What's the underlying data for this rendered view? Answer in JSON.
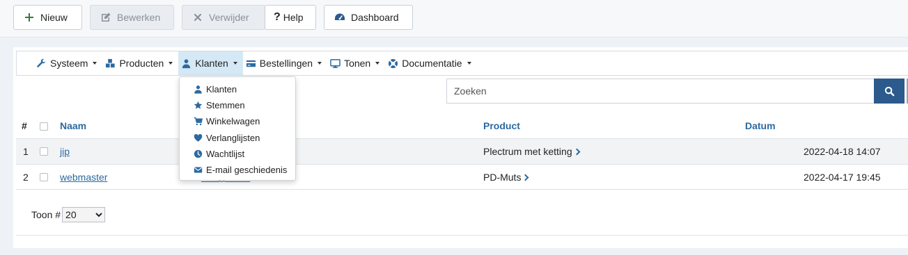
{
  "toolbar": {
    "new_label": "Nieuw",
    "edit_label": "Bewerken",
    "delete_label": "Verwijder",
    "help_label": "Help",
    "dashboard_label": "Dashboard"
  },
  "menu": {
    "systeem": "Systeem",
    "producten": "Producten",
    "klanten": "Klanten",
    "bestellingen": "Bestellingen",
    "tonen": "Tonen",
    "documentatie": "Documentatie"
  },
  "dropdown": {
    "items": [
      "Klanten",
      "Stemmen",
      "Winkelwagen",
      "Verlanglijsten",
      "Wachtlijst",
      "E-mail geschiedenis"
    ]
  },
  "search": {
    "placeholder": "Zoeken"
  },
  "table": {
    "headers": {
      "hash": "#",
      "name": "Naam",
      "product": "Product",
      "date": "Datum"
    },
    "rows": [
      {
        "num": "1",
        "name": "jip",
        "email": "",
        "product": "Plectrum met ketting",
        "date": "2022-04-18 14:07"
      },
      {
        "num": "2",
        "name": "webmaster",
        "email": "info@...s.nl",
        "product": "PD-Muts",
        "date": "2022-04-17 19:45"
      }
    ]
  },
  "pager": {
    "label": "Toon #",
    "selected": "20"
  },
  "colors": {
    "accent": "#2c6aa0",
    "search_button": "#2c5a8c",
    "active_menu": "#d5e8f6"
  }
}
